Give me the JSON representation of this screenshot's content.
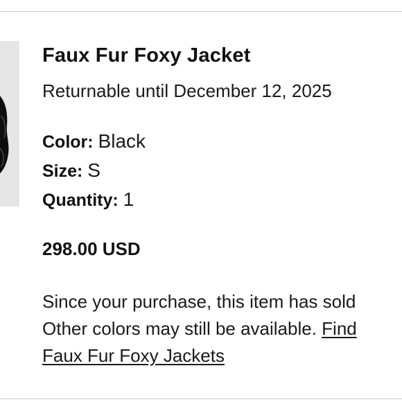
{
  "item": {
    "name": "Faux Fur Foxy Jacket",
    "returnable_text": "Returnable until December 12, 2025",
    "attributes": {
      "color_label": "Color:",
      "color_value": "Black",
      "size_label": "Size:",
      "size_value": "S",
      "quantity_label": "Quantity:",
      "quantity_value": "1"
    },
    "price": "298.00 USD",
    "notice": {
      "line1": "Since your purchase, this item has sold",
      "line2_text": "Other colors may still be available. ",
      "link_part1": "Find",
      "link_part2": "Faux Fur Foxy Jackets"
    }
  },
  "colors": {
    "divider": "#cfcfcf",
    "thumb_bg": "#e6e6e6",
    "text": "#1a1a1a"
  },
  "icons": {
    "product_image": "jacket-photo"
  }
}
